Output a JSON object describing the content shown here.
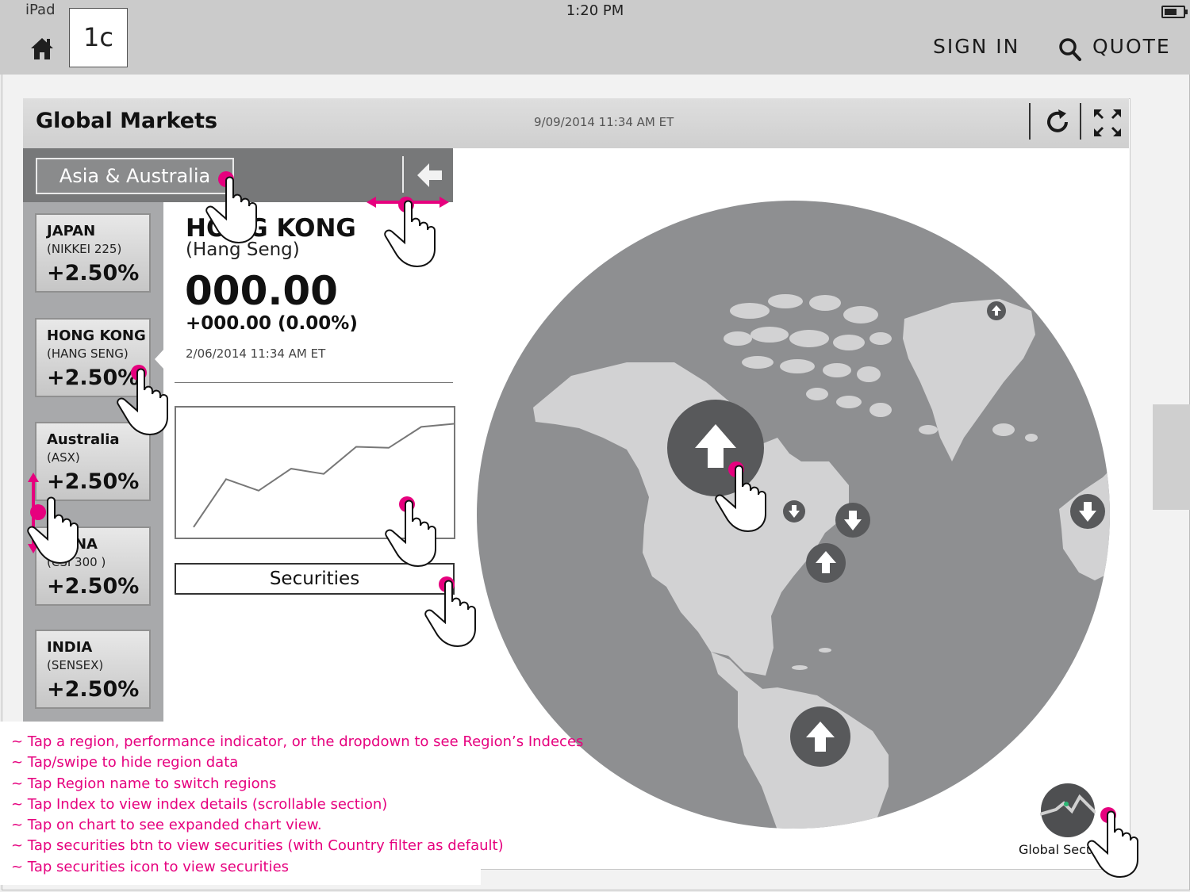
{
  "status_bar": {
    "device": "iPad",
    "time": "1:20 PM"
  },
  "nav": {
    "screen_tag": "1c",
    "sign_in": "SIGN IN",
    "quote": "QUOTE"
  },
  "widget": {
    "title": "Global Markets",
    "timestamp": "9/09/2014 11:34 AM ET",
    "region": "Asia & Australia",
    "indices": [
      {
        "name": "JAPAN",
        "index": "(NIKKEI 225)",
        "change": "+2.50%"
      },
      {
        "name": "HONG KONG",
        "index": "(HANG SENG)",
        "change": "+2.50%"
      },
      {
        "name": "Australia",
        "index": "(ASX)",
        "change": "+2.50%"
      },
      {
        "name": "CHINA",
        "index": "(CSI 300 )",
        "change": "+2.50%"
      },
      {
        "name": "INDIA",
        "index": "(SENSEX)",
        "change": "+2.50%"
      }
    ],
    "detail": {
      "title": "HONG KONG",
      "subtitle": "(Hang Seng)",
      "value": "000.00",
      "change": "+000.00 (0.00%)",
      "timestamp": "2/06/2014 11:34 AM ET",
      "securities_button": "Securities"
    },
    "global_securities_label": "Global Securities"
  },
  "chart_data": {
    "type": "line",
    "x": [
      1,
      2,
      3,
      4,
      5,
      6,
      7,
      8,
      9
    ],
    "values": [
      1,
      5.6,
      4.5,
      6.6,
      6.1,
      8.7,
      8.6,
      10.6,
      10.9
    ],
    "title": "",
    "xlabel": "",
    "ylabel": "",
    "ylim": [
      0,
      12
    ],
    "grid": false
  },
  "map_indicators": [
    {
      "name": "north-america",
      "direction": "up",
      "size": "large"
    },
    {
      "name": "north-pole",
      "direction": "up",
      "size": "tiny"
    },
    {
      "name": "us-midwest",
      "direction": "down",
      "size": "small"
    },
    {
      "name": "us-northeast",
      "direction": "down",
      "size": "medium"
    },
    {
      "name": "us-east",
      "direction": "up",
      "size": "medium"
    },
    {
      "name": "europe",
      "direction": "down",
      "size": "medium"
    },
    {
      "name": "south-america",
      "direction": "up",
      "size": "large"
    }
  ],
  "annotations": [
    "~ Tap a region, performance indicator, or the dropdown to see Region’s Indeces",
    "~ Tap/swipe to hide region data",
    "~ Tap Region name to switch regions",
    "~ Tap Index to view index details (scrollable section)",
    "~ Tap on chart to see expanded chart view.",
    "~ Tap securities btn to view securities (with Country filter as default)",
    "~ Tap securities icon to view securities"
  ],
  "colors": {
    "annotation": "#e6007e",
    "globe_ocean": "#8e8f91",
    "globe_land": "#d2d2d3",
    "indicator": "#58595b"
  }
}
